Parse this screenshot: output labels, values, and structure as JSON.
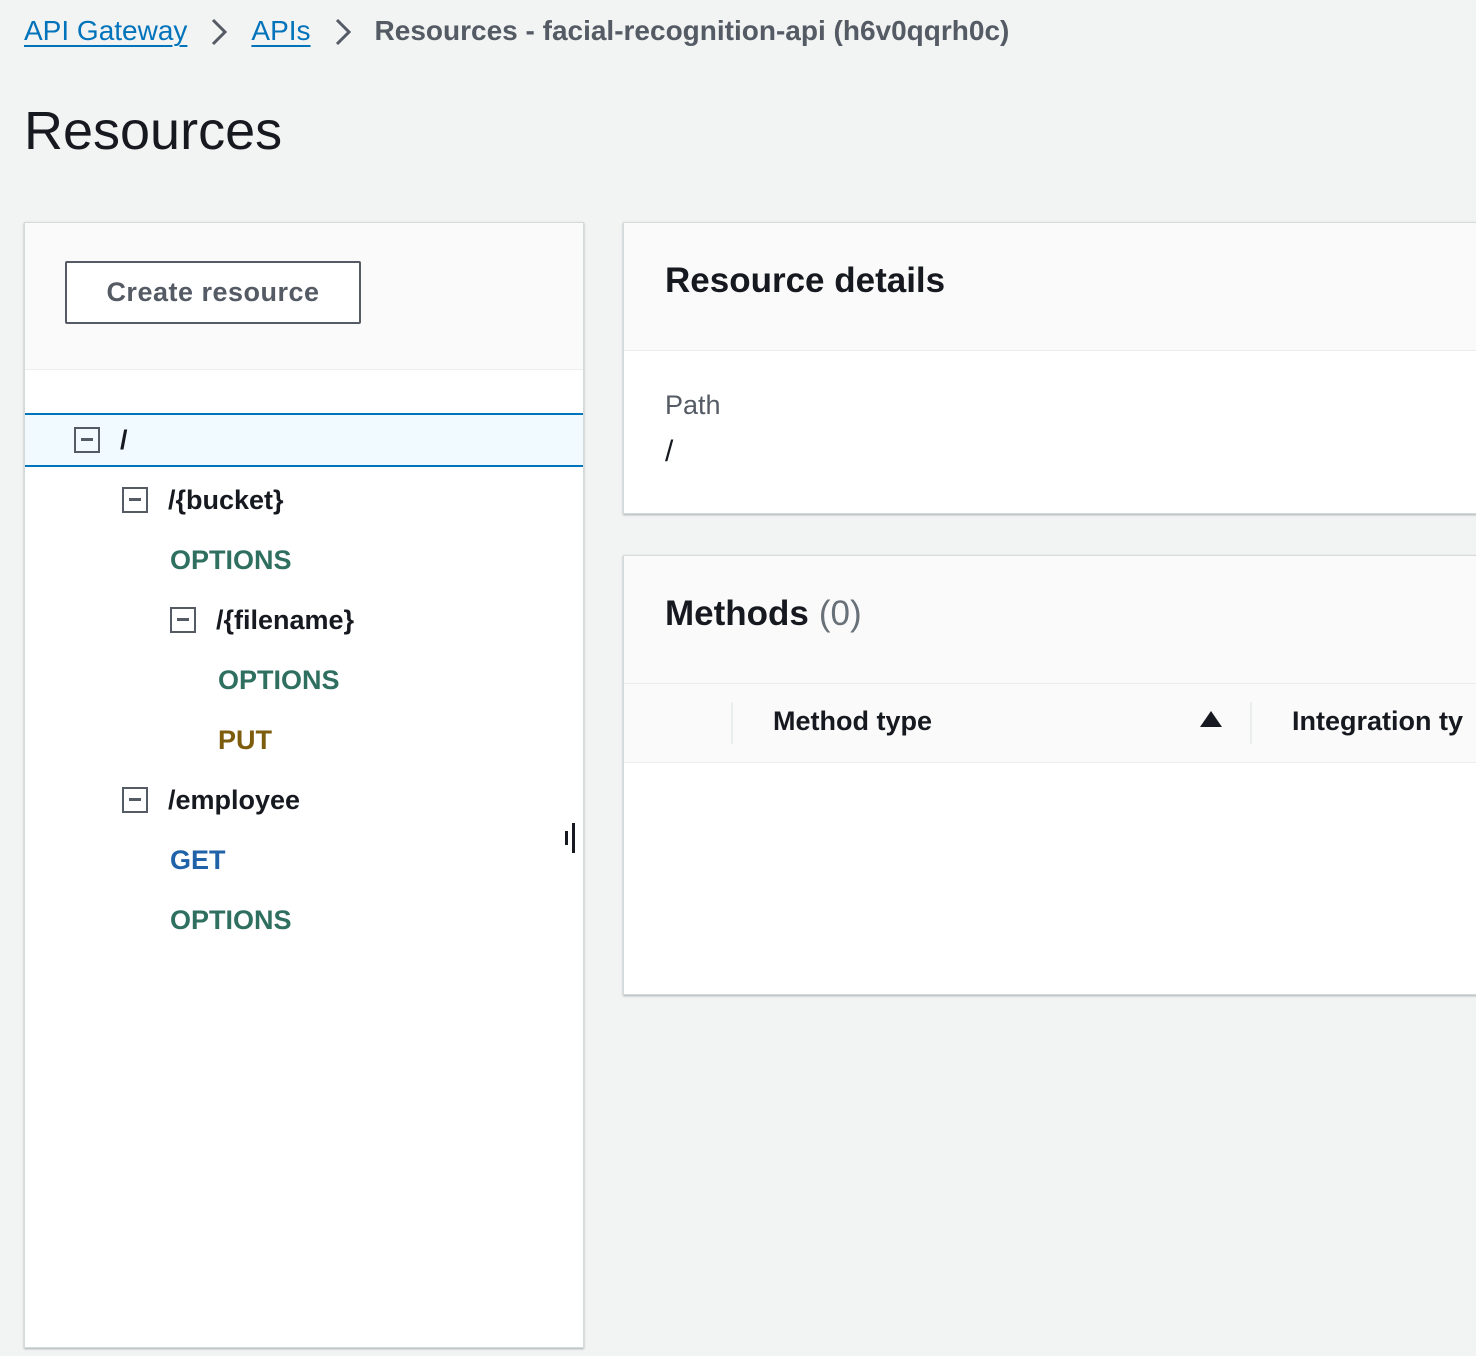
{
  "breadcrumb": {
    "items": [
      {
        "label": "API Gateway"
      },
      {
        "label": "APIs"
      }
    ],
    "current": "Resources - facial-recognition-api (h6v0qqrh0c)"
  },
  "page": {
    "title": "Resources"
  },
  "tree_panel": {
    "create_button_label": "Create resource",
    "nodes": [
      {
        "label": "/",
        "kind": "resource",
        "selected": true
      },
      {
        "label": "/{bucket}",
        "kind": "resource"
      },
      {
        "label": "OPTIONS",
        "kind": "method"
      },
      {
        "label": "/{filename}",
        "kind": "resource"
      },
      {
        "label": "OPTIONS",
        "kind": "method"
      },
      {
        "label": "PUT",
        "kind": "method"
      },
      {
        "label": "/employee",
        "kind": "resource"
      },
      {
        "label": "GET",
        "kind": "method"
      },
      {
        "label": "OPTIONS",
        "kind": "method"
      }
    ]
  },
  "resource_details": {
    "title": "Resource details",
    "path_label": "Path",
    "path_value": "/"
  },
  "methods": {
    "title": "Methods",
    "count": "(0)",
    "columns": [
      "Method type",
      "Integration ty"
    ],
    "sort_direction": "ascending",
    "rows": []
  },
  "colors": {
    "link": "#0073bb",
    "options_method": "#2f6f5f",
    "put_method": "#7d5c0d",
    "get_method": "#1f62a8",
    "selected_row_bg": "#f1faff",
    "selected_row_border": "#0073bb"
  },
  "icons": {
    "breadcrumb_separator": "chevron-right-icon",
    "tree_toggle": "collapse-icon",
    "sort": "sort-ascending-icon"
  }
}
